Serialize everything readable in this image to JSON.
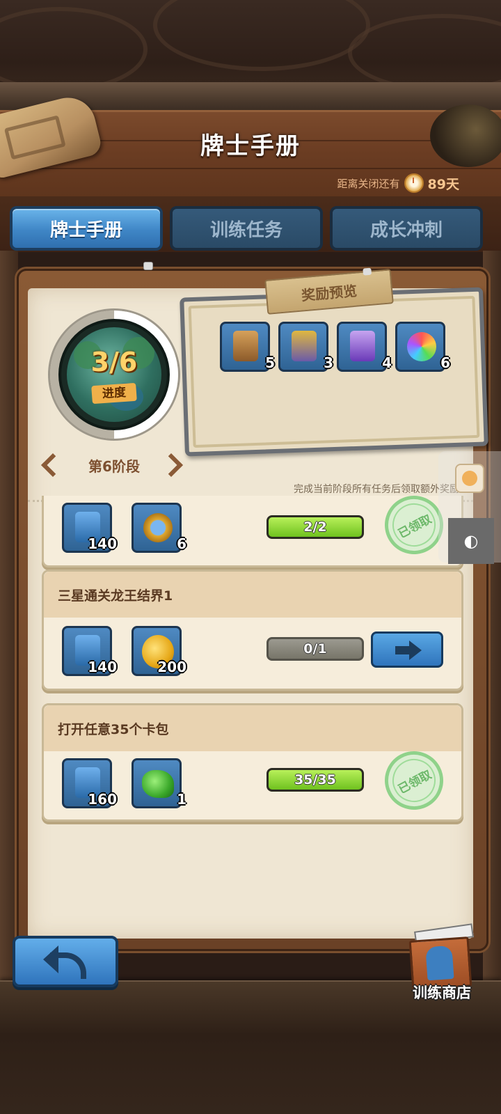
{
  "header": {
    "title": "牌士手册",
    "countdown_label": "距离关闭还有",
    "countdown_days": "89天"
  },
  "tabs": [
    {
      "label": "牌士手册",
      "active": true
    },
    {
      "label": "训练任务",
      "active": false
    },
    {
      "label": "成长冲刺",
      "active": false
    }
  ],
  "progress": {
    "count": "3/6",
    "label": "进度",
    "fraction": 0.5,
    "stage": "第6阶段"
  },
  "reward_preview": {
    "title": "奖励预览",
    "items": [
      {
        "icon": "brown-card-pack-icon",
        "qty": "5"
      },
      {
        "icon": "blue-card-pack-icon",
        "qty": "3"
      },
      {
        "icon": "purple-card-pack-icon",
        "qty": "4"
      },
      {
        "icon": "rainbow-crystal-icon",
        "qty": "6"
      }
    ]
  },
  "hint": "完成当前阶段所有任务后领取额外奖励",
  "tasks": [
    {
      "name": "",
      "rewards": [
        {
          "icon": "trainer-exp-icon",
          "qty": "140"
        },
        {
          "icon": "crystal-coin-icon",
          "qty": "6"
        }
      ],
      "progress": "2/2",
      "status": "已领取"
    },
    {
      "name": "三星通关龙王结界1",
      "rewards": [
        {
          "icon": "trainer-exp-icon",
          "qty": "140"
        },
        {
          "icon": "gold-coin-icon",
          "qty": "200"
        }
      ],
      "progress": "0/1",
      "status": "go"
    },
    {
      "name": "打开任意35个卡包",
      "rewards": [
        {
          "icon": "trainer-exp-icon",
          "qty": "160"
        },
        {
          "icon": "green-gem-icon",
          "qty": "1"
        }
      ],
      "progress": "35/35",
      "status": "已领取"
    }
  ],
  "footer": {
    "shop_label": "训练商店"
  },
  "colors": {
    "tab_active": "#3f86c6",
    "progress_full": "#6fc21f",
    "progress_empty": "#777569",
    "stamp": "#8fd28a"
  }
}
